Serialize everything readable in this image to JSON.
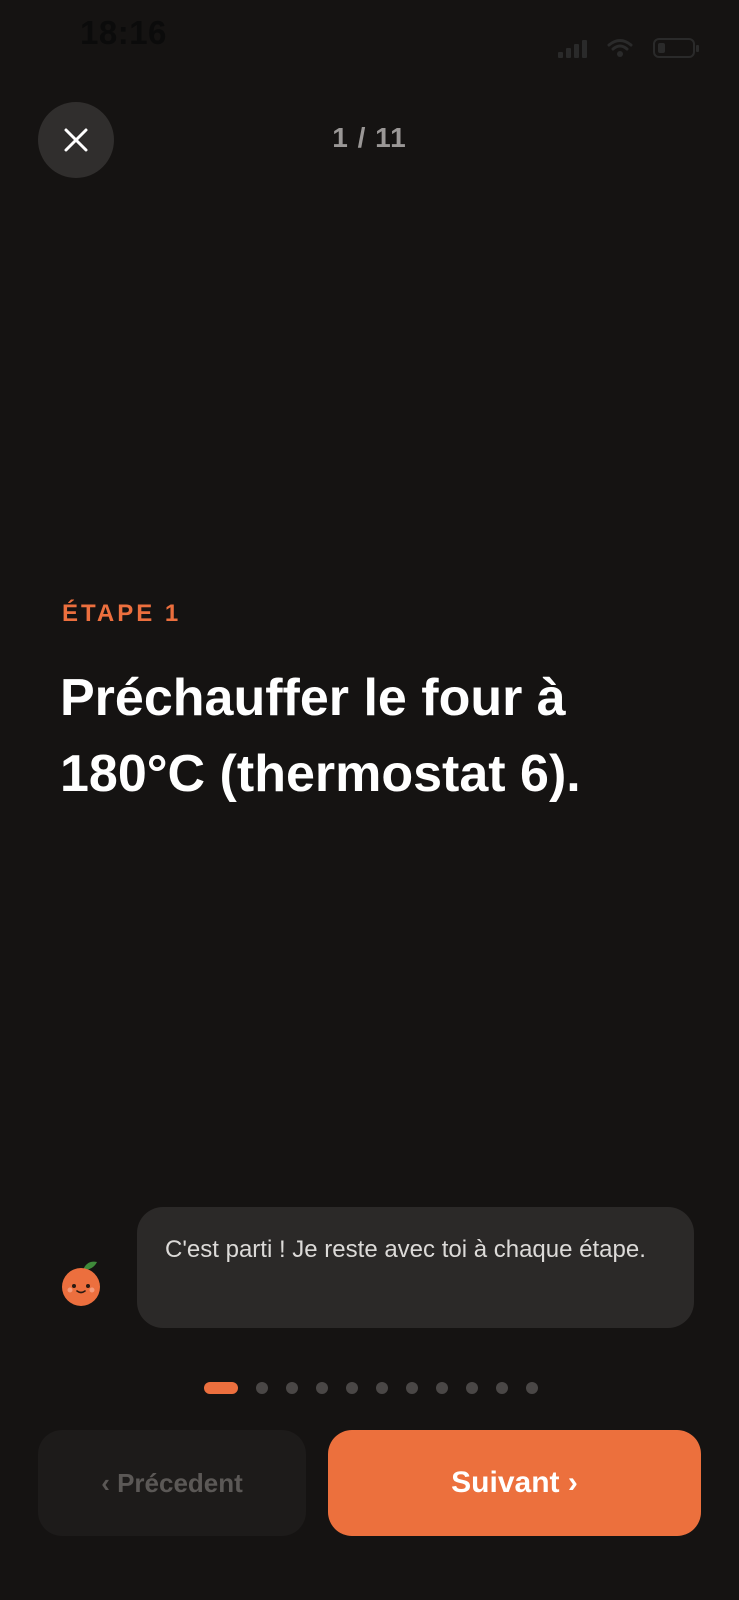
{
  "status_bar": {
    "time": "18:16",
    "icons": [
      "signal-icon",
      "wifi-icon",
      "battery-icon"
    ]
  },
  "header": {
    "close_icon": "close-icon",
    "progress": "1 / 11"
  },
  "step": {
    "label": "ÉTAPE 1",
    "text": "Préchauffer le four à 180°C (thermostat 6)."
  },
  "assistant": {
    "avatar_icon": "orange-mascot-icon",
    "message": "C'est parti ! Je reste avec toi à chaque étape."
  },
  "pagination": {
    "current": 1,
    "total": 11
  },
  "nav": {
    "prev_label": "‹ Précedent",
    "next_label": "Suivant ›"
  },
  "colors": {
    "background": "#151312",
    "accent": "#ec6f3e",
    "bubble": "#2b2928"
  }
}
